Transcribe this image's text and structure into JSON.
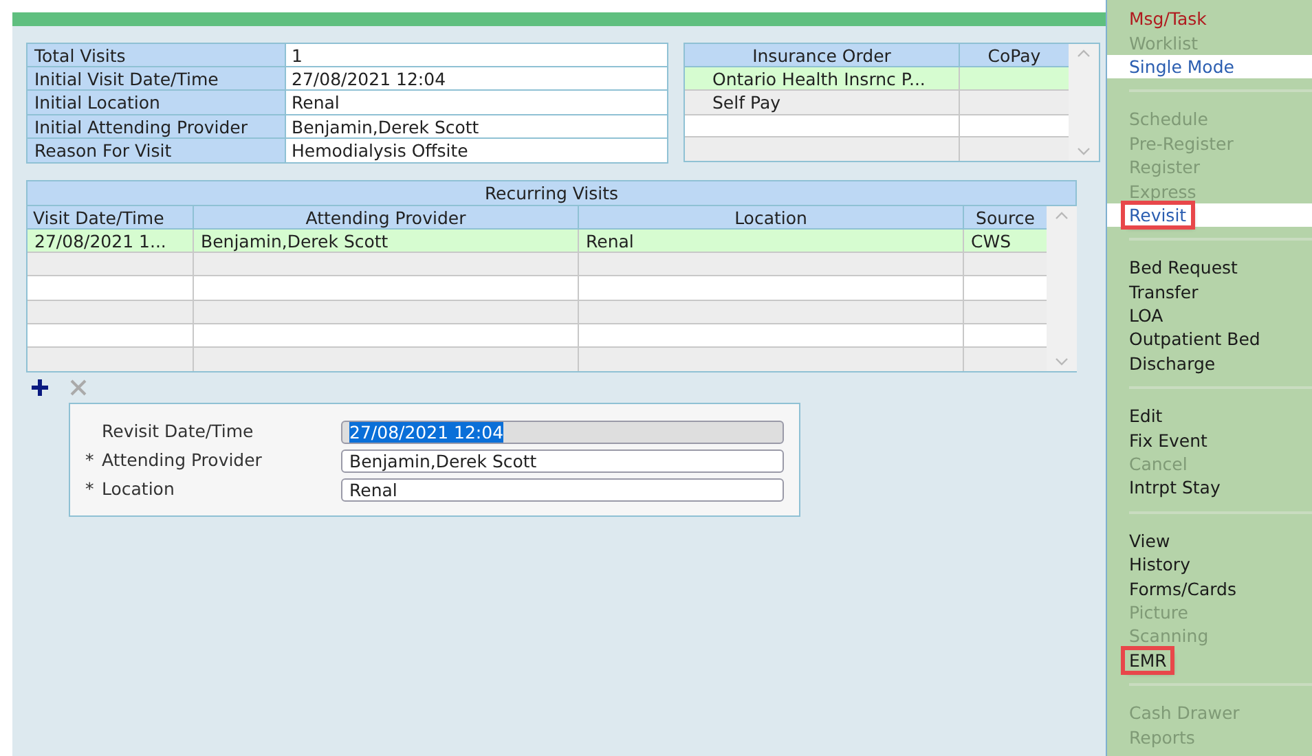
{
  "summary": {
    "rows": [
      {
        "label": "Total Visits",
        "value": "1"
      },
      {
        "label": "Initial Visit Date/Time",
        "value": "27/08/2021 12:04"
      },
      {
        "label": "Initial Location",
        "value": "Renal"
      },
      {
        "label": "Initial Attending Provider",
        "value": "Benjamin,Derek Scott"
      },
      {
        "label": "Reason For Visit",
        "value": "Hemodialysis Offsite"
      }
    ]
  },
  "insurance": {
    "columns": [
      "Insurance Order",
      "CoPay"
    ],
    "rows": [
      {
        "order": "Ontario Health Insrnc P...",
        "selected": true
      },
      {
        "order": "Self Pay",
        "selected": false
      }
    ]
  },
  "recurring_visits": {
    "title": "Recurring Visits",
    "columns": [
      "Visit Date/Time",
      "Attending Provider",
      "Location",
      "Source"
    ],
    "rows": [
      {
        "cells": [
          "27/08/2021 1...",
          "Benjamin,Derek Scott",
          "Renal",
          "CWS"
        ],
        "selected": true
      }
    ]
  },
  "row_actions": {
    "add_disabled": false,
    "remove_disabled": true
  },
  "revisit_form": {
    "required_mark": "*",
    "fields": [
      {
        "label": "Revisit Date/Time",
        "required": false,
        "value": "27/08/2021 12:04",
        "disabled": true,
        "value_selected": true
      },
      {
        "label": "Attending Provider",
        "required": true,
        "value": "Benjamin,Derek Scott",
        "disabled": false,
        "value_selected": false
      },
      {
        "label": "Location",
        "required": true,
        "value": "Renal",
        "disabled": false,
        "value_selected": false
      }
    ]
  },
  "sidebar": {
    "groups": [
      {
        "items": [
          {
            "label": "Msg/Task",
            "kind": "alert",
            "disabled": false,
            "selected": false,
            "outlined": false
          },
          {
            "label": "Worklist",
            "kind": "action",
            "disabled": true,
            "selected": false,
            "outlined": false
          },
          {
            "label": "Single Mode",
            "kind": "action",
            "disabled": false,
            "selected": true,
            "outlined": false
          }
        ]
      },
      {
        "items": [
          {
            "label": "Schedule",
            "kind": "action",
            "disabled": true,
            "selected": false,
            "outlined": false
          },
          {
            "label": "Pre-Register",
            "kind": "action",
            "disabled": true,
            "selected": false,
            "outlined": false
          },
          {
            "label": "Register",
            "kind": "action",
            "disabled": true,
            "selected": false,
            "outlined": false
          },
          {
            "label": "Express",
            "kind": "action",
            "disabled": true,
            "selected": false,
            "outlined": false
          },
          {
            "label": "Revisit",
            "kind": "action",
            "disabled": false,
            "selected": true,
            "outlined": true
          }
        ]
      },
      {
        "items": [
          {
            "label": "Bed Request",
            "kind": "action",
            "disabled": false,
            "selected": false,
            "outlined": false
          },
          {
            "label": "Transfer",
            "kind": "action",
            "disabled": false,
            "selected": false,
            "outlined": false
          },
          {
            "label": "LOA",
            "kind": "action",
            "disabled": false,
            "selected": false,
            "outlined": false
          },
          {
            "label": "Outpatient Bed",
            "kind": "action",
            "disabled": false,
            "selected": false,
            "outlined": false
          },
          {
            "label": "Discharge",
            "kind": "action",
            "disabled": false,
            "selected": false,
            "outlined": false
          }
        ]
      },
      {
        "items": [
          {
            "label": "Edit",
            "kind": "action",
            "disabled": false,
            "selected": false,
            "outlined": false
          },
          {
            "label": "Fix Event",
            "kind": "action",
            "disabled": false,
            "selected": false,
            "outlined": false
          },
          {
            "label": "Cancel",
            "kind": "action",
            "disabled": true,
            "selected": false,
            "outlined": false
          },
          {
            "label": "Intrpt Stay",
            "kind": "action",
            "disabled": false,
            "selected": false,
            "outlined": false
          }
        ]
      },
      {
        "items": [
          {
            "label": "View",
            "kind": "action",
            "disabled": false,
            "selected": false,
            "outlined": false
          },
          {
            "label": "History",
            "kind": "action",
            "disabled": false,
            "selected": false,
            "outlined": false
          },
          {
            "label": "Forms/Cards",
            "kind": "action",
            "disabled": false,
            "selected": false,
            "outlined": false
          },
          {
            "label": "Picture",
            "kind": "action",
            "disabled": true,
            "selected": false,
            "outlined": false
          },
          {
            "label": "Scanning",
            "kind": "action",
            "disabled": true,
            "selected": false,
            "outlined": false
          },
          {
            "label": "EMR",
            "kind": "action",
            "disabled": false,
            "selected": false,
            "outlined": true
          }
        ]
      },
      {
        "items": [
          {
            "label": "Cash Drawer",
            "kind": "action",
            "disabled": true,
            "selected": false,
            "outlined": false
          },
          {
            "label": "Reports",
            "kind": "action",
            "disabled": true,
            "selected": false,
            "outlined": false
          }
        ]
      }
    ]
  }
}
